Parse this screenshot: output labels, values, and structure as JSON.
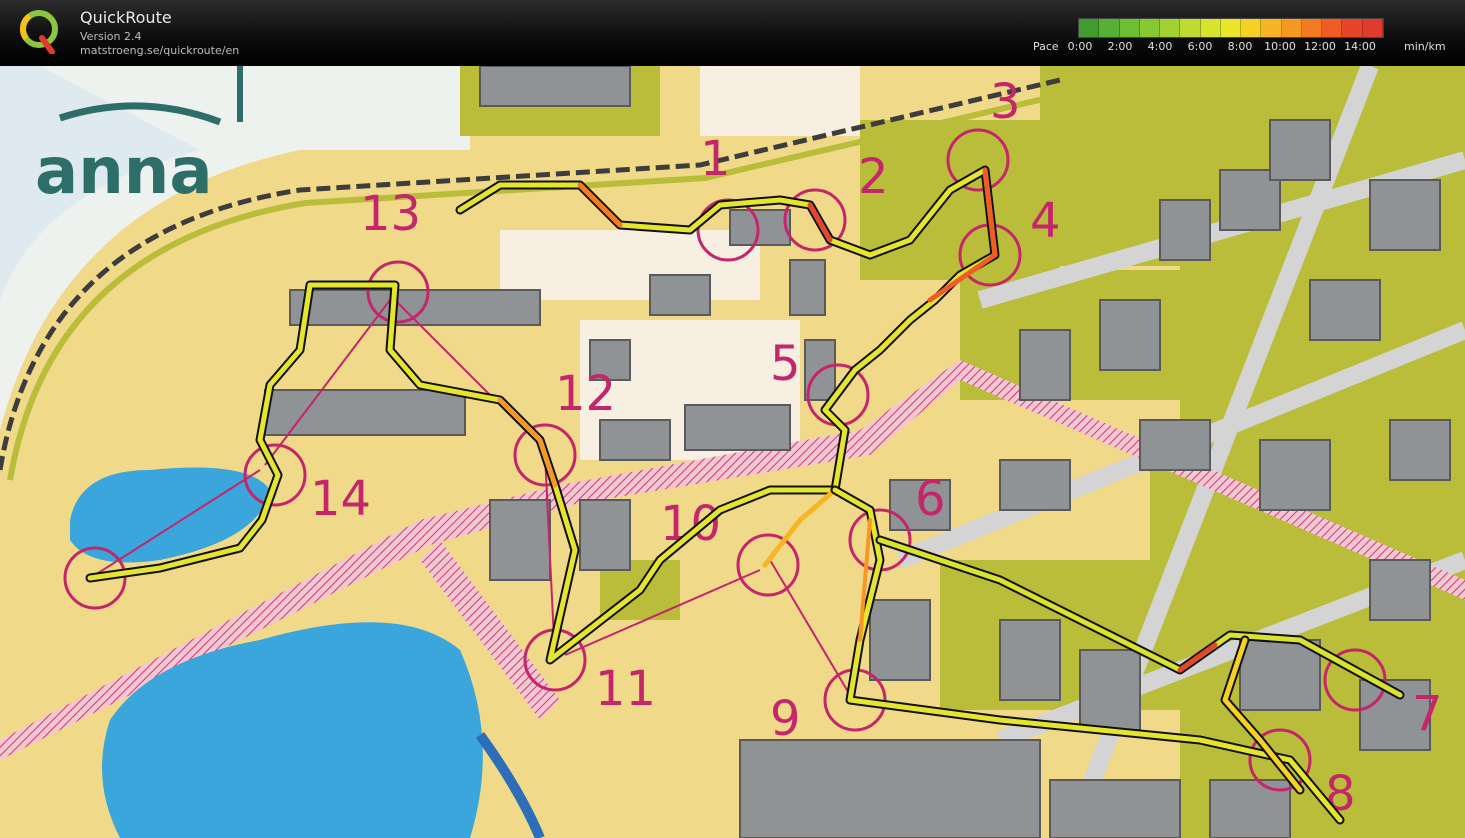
{
  "app": {
    "name": "QuickRoute",
    "version": "Version 2.4",
    "url": "matstroeng.se/quickroute/en",
    "logo_letter": "Q"
  },
  "pace_legend": {
    "label": "Pace",
    "ticks": [
      "0:00",
      "2:00",
      "4:00",
      "6:00",
      "8:00",
      "10:00",
      "12:00",
      "14:00"
    ],
    "unit": "min/km",
    "colors": [
      "#3f9d2f",
      "#55b034",
      "#6cbe35",
      "#87c833",
      "#a2d231",
      "#bedc2f",
      "#d7e32c",
      "#ebe529",
      "#f5d126",
      "#f7b524",
      "#f79822",
      "#f47b22",
      "#ef5d24",
      "#e84528",
      "#e13a2e"
    ]
  },
  "map": {
    "brand_text": "anna",
    "controls": [
      {
        "label": "1"
      },
      {
        "label": "2"
      },
      {
        "label": "3"
      },
      {
        "label": "4"
      },
      {
        "label": "5"
      },
      {
        "label": "6"
      },
      {
        "label": "7"
      },
      {
        "label": "8"
      },
      {
        "label": "9"
      },
      {
        "label": "10"
      },
      {
        "label": "11"
      },
      {
        "label": "12"
      },
      {
        "label": "13"
      },
      {
        "label": "14"
      }
    ]
  }
}
